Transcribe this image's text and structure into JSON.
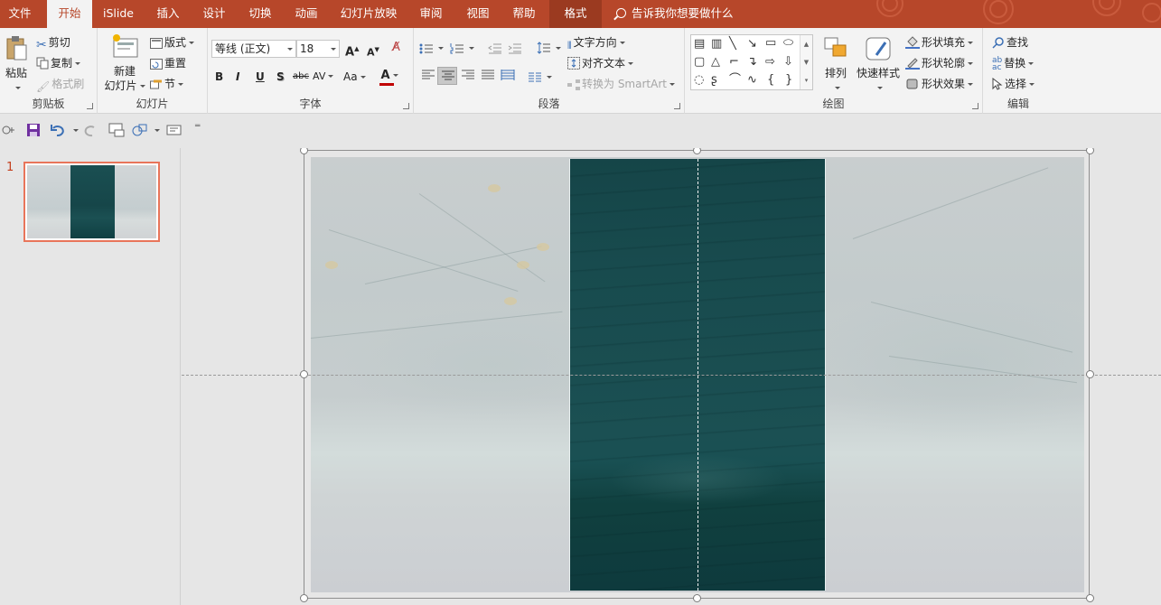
{
  "tabs": [
    {
      "label": "文件",
      "active": false
    },
    {
      "label": "开始",
      "active": true
    },
    {
      "label": "iSlide",
      "active": false
    },
    {
      "label": "插入",
      "active": false
    },
    {
      "label": "设计",
      "active": false
    },
    {
      "label": "切换",
      "active": false
    },
    {
      "label": "动画",
      "active": false
    },
    {
      "label": "幻灯片放映",
      "active": false
    },
    {
      "label": "审阅",
      "active": false
    },
    {
      "label": "视图",
      "active": false
    },
    {
      "label": "帮助",
      "active": false
    },
    {
      "label": "格式",
      "active": false
    }
  ],
  "tell_me": "告诉我你想要做什么",
  "clipboard": {
    "label": "剪贴板",
    "paste": "粘贴",
    "cut": "剪切",
    "copy": "复制",
    "format_painter": "格式刷"
  },
  "slides_group": {
    "label": "幻灯片",
    "new_slide_line1": "新建",
    "new_slide_line2": "幻灯片",
    "layout": "版式",
    "reset": "重置",
    "section": "节"
  },
  "font": {
    "label": "字体",
    "name": "等线 (正文)",
    "size": "18",
    "bold": "B",
    "italic": "I",
    "underline": "U",
    "shadow": "S",
    "strike": "abc",
    "spacing": "AV",
    "case": "Aa",
    "color_letter": "A",
    "grow": "A",
    "shrink": "A",
    "font_color": "#c00000"
  },
  "paragraph": {
    "label": "段落",
    "text_direction": "文字方向",
    "align_text": "对齐文本",
    "smartart": "转换为 SmartArt"
  },
  "drawing": {
    "label": "绘图",
    "arrange": "排列",
    "quick_styles": "快速样式",
    "shape_fill": "形状填充",
    "shape_outline": "形状轮廓",
    "shape_effects": "形状效果"
  },
  "editing": {
    "label": "编辑",
    "find": "查找",
    "replace": "替换",
    "select": "选择"
  },
  "thumbnails": [
    {
      "number": "1",
      "selected": true
    }
  ],
  "colors": {
    "accent": "#b7472a",
    "strip": "#1a4e51",
    "thumb_border": "#e8755a"
  }
}
